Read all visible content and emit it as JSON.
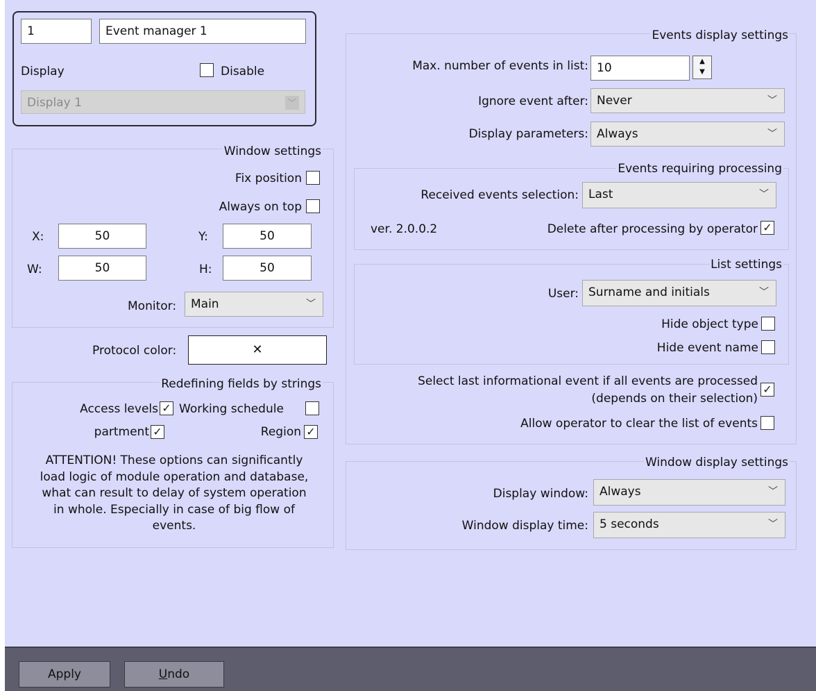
{
  "top": {
    "id_value": "1",
    "name_value": "Event manager 1",
    "display_label": "Display",
    "disable_label": "Disable",
    "display_select": "Display 1"
  },
  "window_settings": {
    "title": "Window settings",
    "fix_position": "Fix position",
    "always_on_top": "Always on top",
    "x_label": "X:",
    "x_value": "50",
    "y_label": "Y:",
    "y_value": "50",
    "w_label": "W:",
    "w_value": "50",
    "h_label": "H:",
    "h_value": "50",
    "monitor_label": "Monitor:",
    "monitor_value": "Main"
  },
  "protocol": {
    "label": "Protocol color:",
    "value": "✕"
  },
  "redefining": {
    "title": "Redefining fields by strings",
    "access_levels": "Access levels",
    "working_schedule": "Working schedule",
    "department": "partment",
    "region": "Region",
    "attention": [
      "ATTENTION! These options can significantly",
      "load logic of module operation and database,",
      "what can result to delay of system operation",
      "in whole. Especially in case of big flow of",
      "events."
    ]
  },
  "events_display": {
    "title": "Events display settings",
    "max_events_label": "Max. number of events in list:",
    "max_events_value": "10",
    "ignore_label": "Ignore event after:",
    "ignore_value": "Never",
    "params_label": "Display parameters:",
    "params_value": "Always"
  },
  "processing": {
    "title": "Events requiring processing",
    "received_label": "Received events selection:",
    "received_value": "Last",
    "version": "ver. 2.0.0.2",
    "delete_label": "Delete after processing by operator"
  },
  "list_settings": {
    "title": "List settings",
    "user_label": "User:",
    "user_value": "Surname and initials",
    "hide_object_type": "Hide object type",
    "hide_event_name": "Hide event name"
  },
  "misc": {
    "select_last_1": "Select last informational event if all events are processed",
    "select_last_2": "(depends on their selection)",
    "allow_clear": "Allow operator to clear the list of events"
  },
  "window_display": {
    "title": "Window display settings",
    "display_window_label": "Display window:",
    "display_window_value": "Always",
    "time_label": "Window display time:",
    "time_value": "5 seconds"
  },
  "buttons": {
    "apply": "Apply",
    "undo_u": "U",
    "undo_rest": "ndo"
  },
  "icons": {
    "dropdown": "chevron-down-icon",
    "check": "checkmark-icon",
    "spin": "spin-arrows-icon"
  }
}
